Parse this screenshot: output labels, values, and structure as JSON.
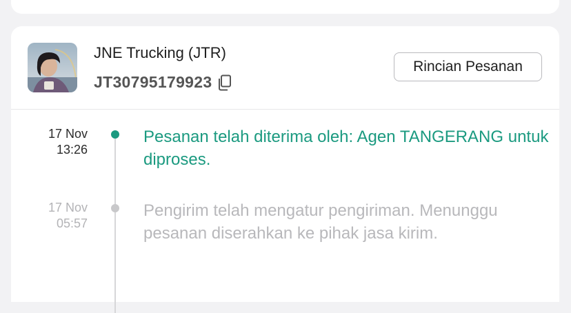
{
  "order": {
    "courier_name": "JNE Trucking (JTR)",
    "tracking_number": "JT30795179923",
    "detail_button_label": "Rincian Pesanan",
    "avatar_icon": "user-photo-avatar",
    "copy_icon": "copy-icon"
  },
  "timeline": {
    "events": [
      {
        "date": "17 Nov",
        "time": "13:26",
        "text": "Pesanan telah diterima oleh: Agen TANGERANG untuk diproses.",
        "status": "active"
      },
      {
        "date": "17 Nov",
        "time": "05:57",
        "text": "Pengirim telah mengatur pengiriman. Menunggu pesanan diserahkan ke pihak jasa kirim.",
        "status": "past"
      }
    ]
  },
  "colors": {
    "accent": "#1b9a80",
    "muted_text": "#b8b8bb",
    "background": "#f2f2f4"
  }
}
